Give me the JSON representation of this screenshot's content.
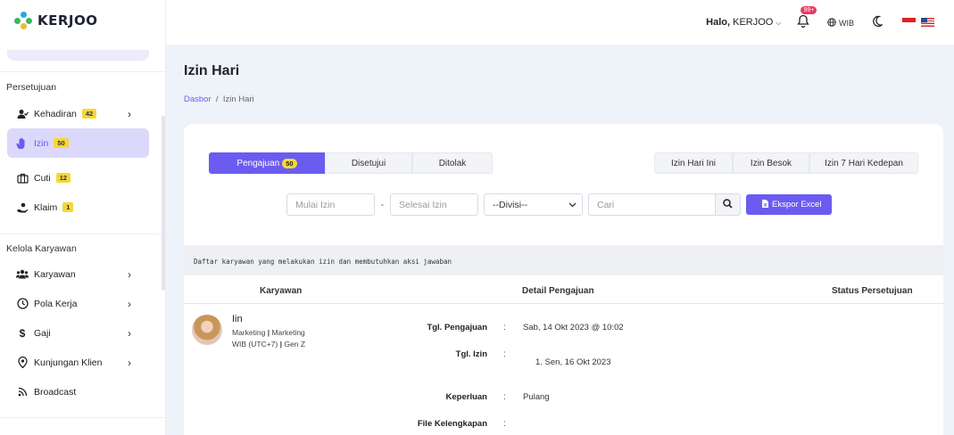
{
  "app": {
    "logo_text": "KERJOO",
    "brand_color": "#6a5cf0"
  },
  "header": {
    "greeting_prefix": "Halo,",
    "user": "KERJOO",
    "notif_count": "99+",
    "timezone": "WIB"
  },
  "sidebar": {
    "sections": [
      {
        "title": "Persetujuan",
        "items": [
          {
            "label": "Kehadiran",
            "badge": "42",
            "icon": "user-check-icon",
            "chevron": true
          },
          {
            "label": "Izin",
            "badge": "50",
            "icon": "hand-icon",
            "active": true
          },
          {
            "label": "Cuti",
            "badge": "12",
            "icon": "briefcase-icon"
          },
          {
            "label": "Klaim",
            "badge": "1",
            "icon": "hand-money-icon"
          }
        ]
      },
      {
        "title": "Kelola Karyawan",
        "items": [
          {
            "label": "Karyawan",
            "icon": "users-icon",
            "chevron": true
          },
          {
            "label": "Pola Kerja",
            "icon": "clock-icon",
            "chevron": true
          },
          {
            "label": "Gaji",
            "icon": "dollar-icon",
            "chevron": true
          },
          {
            "label": "Kunjungan Klien",
            "icon": "map-pin-icon",
            "chevron": true
          },
          {
            "label": "Broadcast",
            "icon": "rss-icon"
          }
        ]
      }
    ]
  },
  "page": {
    "title": "Izin Hari",
    "breadcrumb": [
      "Dasbor",
      "Izin Hari"
    ]
  },
  "tabs": {
    "status": [
      {
        "label": "Pengajuan",
        "count": "50",
        "selected": true
      },
      {
        "label": "Disetujui"
      },
      {
        "label": "Ditolak"
      }
    ],
    "range": [
      {
        "label": "Izin Hari Ini"
      },
      {
        "label": "Izin Besok"
      },
      {
        "label": "Izin 7 Hari Kedepan"
      }
    ]
  },
  "filters": {
    "start_placeholder": "Mulai Izin",
    "end_placeholder": "Selesai Izin",
    "division_selected": "--Divisi--",
    "search_placeholder": "Cari",
    "export_label": "Ekspor Excel"
  },
  "notice": "Daftar karyawan yang melakukan izin dan membutuhkan aksi jawaban",
  "table": {
    "columns": [
      "Karyawan",
      "Detail Pengajuan",
      "Status Persetujuan"
    ],
    "rows": [
      {
        "name": "Iin",
        "dept_a": "Marketing",
        "dept_b": "Marketing",
        "zone": "WIB (UTC+7)",
        "generation": "Gen Z",
        "details": [
          {
            "label": "Tgl. Pengajuan",
            "value": "Sab, 14 Okt 2023 @ 10:02"
          },
          {
            "label": "Tgl. Izin",
            "value": "1. Sen, 16 Okt 2023"
          },
          {
            "label": "Keperluan",
            "value": "Pulang"
          },
          {
            "label": "File Kelengkapan",
            "value": ""
          }
        ]
      }
    ]
  }
}
